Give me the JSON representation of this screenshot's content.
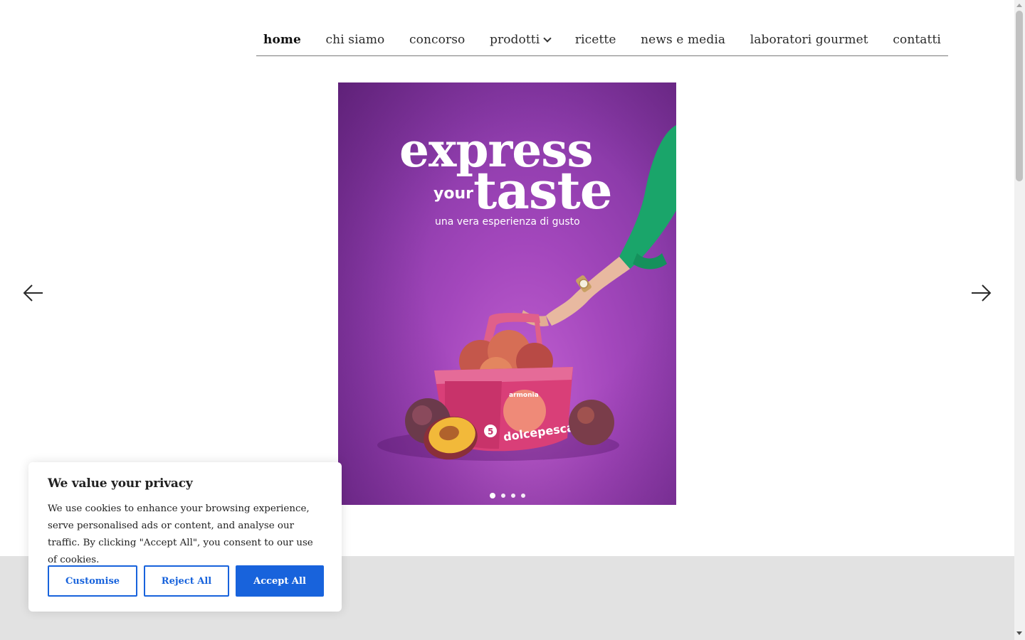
{
  "nav": {
    "items": [
      {
        "label": "home",
        "active": true
      },
      {
        "label": "chi siamo"
      },
      {
        "label": "concorso"
      },
      {
        "label": "prodotti",
        "has_dropdown": true
      },
      {
        "label": "ricette"
      },
      {
        "label": "news e media"
      },
      {
        "label": "laboratori gourmet"
      },
      {
        "label": "contatti"
      }
    ]
  },
  "hero": {
    "headline_line1": "express",
    "headline_small": "your",
    "headline_line2": "taste",
    "subline": "una vera esperienza di gusto",
    "slide_count": 4,
    "active_slide": 1,
    "background_color": "#a347bc"
  },
  "carousel": {
    "prev_icon": "arrow-left-icon",
    "next_icon": "arrow-right-icon"
  },
  "cookie": {
    "title": "We value your privacy",
    "text": "We use cookies to enhance your browsing experience, serve personalised ads or content, and analyse our traffic. By clicking \"Accept All\", you consent to our use of cookies.",
    "customise_label": "Customise",
    "reject_label": "Reject All",
    "accept_label": "Accept All",
    "accent_color": "#1863dc"
  }
}
